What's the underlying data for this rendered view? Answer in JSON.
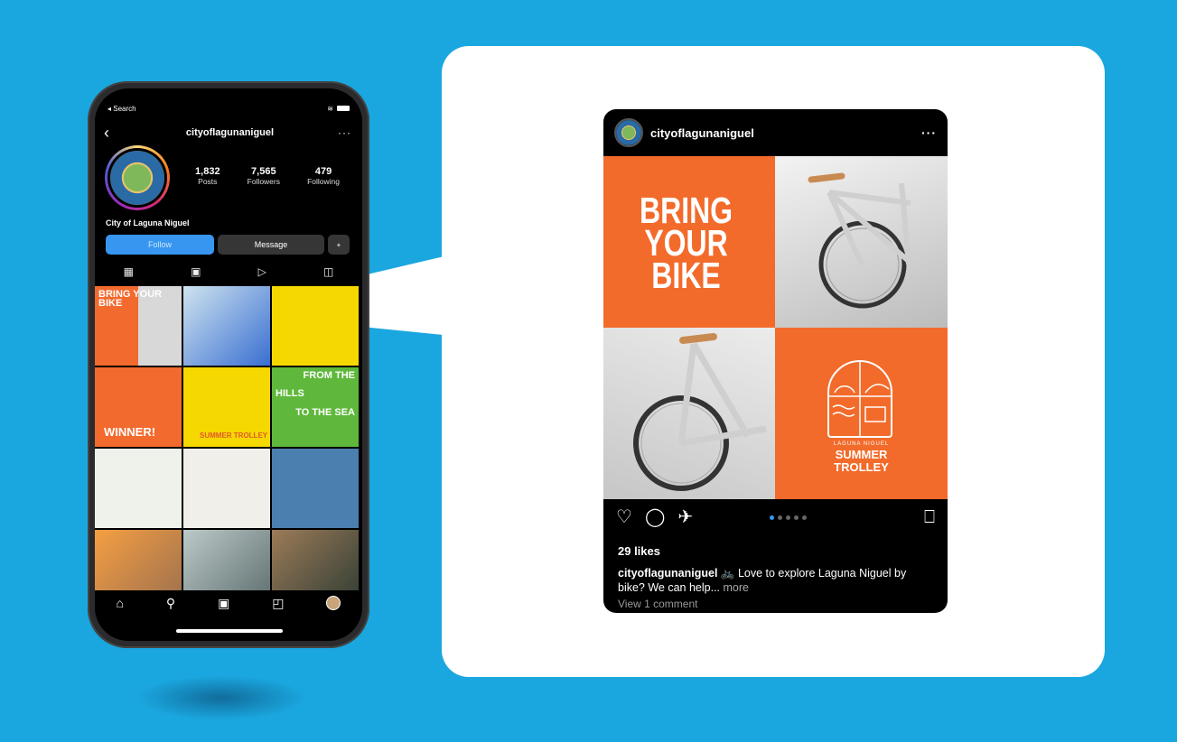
{
  "phone": {
    "status_left": "◂ Search",
    "username": "cityoflagunaniguel",
    "back_icon": "‹",
    "more_icon": "···",
    "stats": [
      {
        "value": "1,832",
        "label": "Posts"
      },
      {
        "value": "7,565",
        "label": "Followers"
      },
      {
        "value": "479",
        "label": "Following"
      }
    ],
    "profile_name": "City of Laguna Niguel",
    "follow_label": "Follow",
    "message_label": "Message",
    "add_user_label": "+",
    "grid_texts": {
      "bring": "BRING YOUR BIKE",
      "winner": "WINNER!",
      "summer": "SUMMER TROLLEY",
      "hills_line1": "FROM THE",
      "hills_line2": "HILLS",
      "hills_line3": "TO THE SEA"
    }
  },
  "post": {
    "username": "cityoflagunaniguel",
    "more_icon": "···",
    "headline_line1": "BRING",
    "headline_line2": "YOUR",
    "headline_line3": "BIKE",
    "logo_small": "LAGUNA NIGUEL",
    "logo_line1": "SUMMER",
    "logo_line2": "TROLLEY",
    "likes": "29 likes",
    "caption_user": "cityoflagunaniguel",
    "caption_text": " 🚲 Love to explore Laguna Niguel by bike? We can help...",
    "caption_more": " more",
    "view_comments": "View 1 comment",
    "carousel_count": 5,
    "carousel_active": 0
  },
  "colors": {
    "background": "#1aa7df",
    "accent_orange": "#f26b2b",
    "follow_blue": "#3797f0"
  },
  "icons": [
    "heart-icon",
    "comment-icon",
    "share-icon",
    "bookmark-icon",
    "grid-icon",
    "reels-icon",
    "play-icon",
    "tagged-icon",
    "home-icon",
    "search-icon",
    "shop-icon"
  ]
}
